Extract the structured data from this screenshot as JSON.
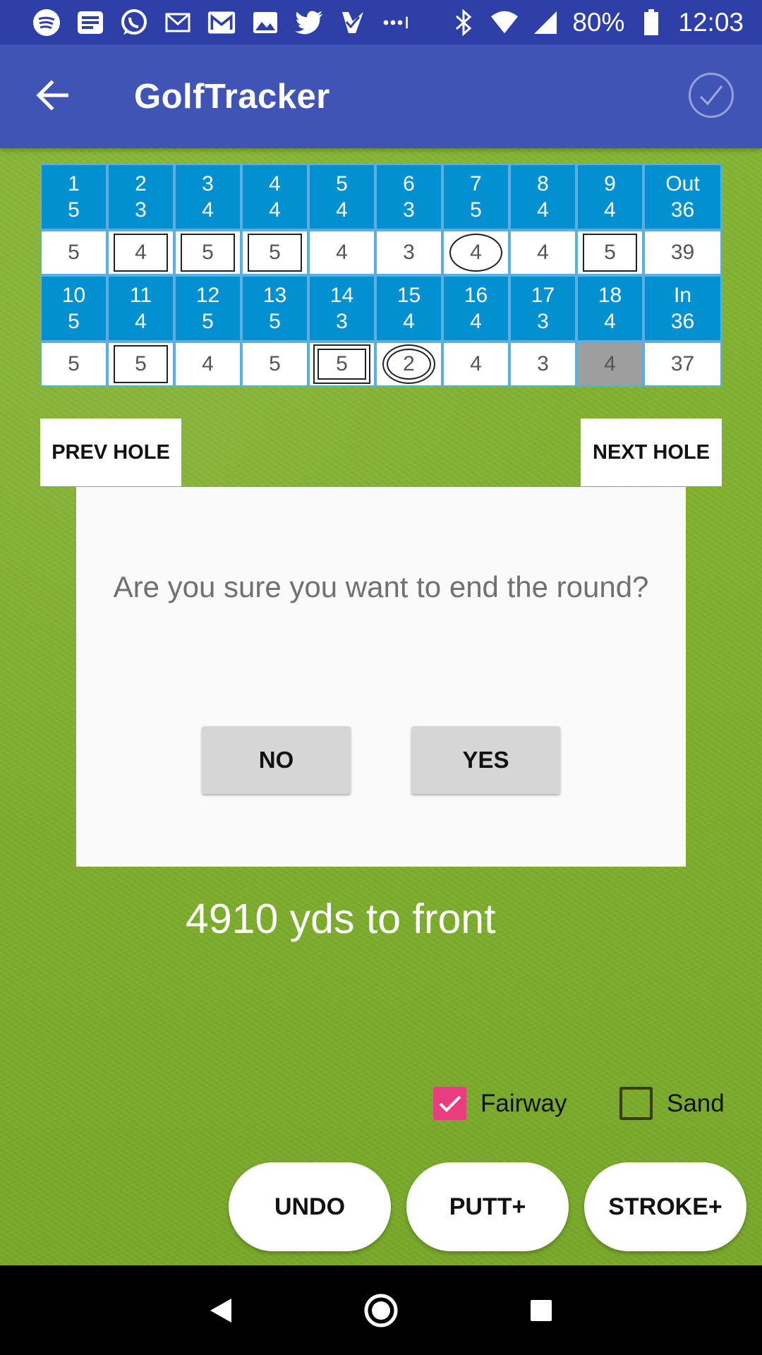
{
  "status_bar": {
    "battery": "80%",
    "time": "12:03",
    "left_icons": [
      "spotify-icon",
      "news-icon",
      "whatsapp-icon",
      "mail-icon",
      "gmail-icon",
      "photos-icon",
      "twitter-icon",
      "check-app-icon",
      "more-dots-icon"
    ],
    "right_icons": [
      "bluetooth-icon",
      "wifi-icon",
      "signal-icon",
      "battery-icon"
    ]
  },
  "app_bar": {
    "title": "GolfTracker"
  },
  "scorecard": {
    "front": {
      "holes": [
        {
          "hole": "1",
          "par": "5",
          "score": "5",
          "mark": "none"
        },
        {
          "hole": "2",
          "par": "3",
          "score": "4",
          "mark": "box"
        },
        {
          "hole": "3",
          "par": "4",
          "score": "5",
          "mark": "box"
        },
        {
          "hole": "4",
          "par": "4",
          "score": "5",
          "mark": "box"
        },
        {
          "hole": "5",
          "par": "4",
          "score": "4",
          "mark": "none"
        },
        {
          "hole": "6",
          "par": "3",
          "score": "3",
          "mark": "none"
        },
        {
          "hole": "7",
          "par": "5",
          "score": "4",
          "mark": "circle"
        },
        {
          "hole": "8",
          "par": "4",
          "score": "4",
          "mark": "none"
        },
        {
          "hole": "9",
          "par": "4",
          "score": "5",
          "mark": "box"
        }
      ],
      "total_label": "Out",
      "total_par": "36",
      "total_score": "39"
    },
    "back": {
      "holes": [
        {
          "hole": "10",
          "par": "5",
          "score": "5",
          "mark": "none"
        },
        {
          "hole": "11",
          "par": "4",
          "score": "5",
          "mark": "box"
        },
        {
          "hole": "12",
          "par": "5",
          "score": "4",
          "mark": "none"
        },
        {
          "hole": "13",
          "par": "5",
          "score": "5",
          "mark": "none"
        },
        {
          "hole": "14",
          "par": "3",
          "score": "5",
          "mark": "double-box"
        },
        {
          "hole": "15",
          "par": "4",
          "score": "2",
          "mark": "double-circle"
        },
        {
          "hole": "16",
          "par": "4",
          "score": "4",
          "mark": "none"
        },
        {
          "hole": "17",
          "par": "3",
          "score": "3",
          "mark": "none"
        },
        {
          "hole": "18",
          "par": "4",
          "score": "4",
          "mark": "current"
        }
      ],
      "total_label": "In",
      "total_par": "36",
      "total_score": "37"
    }
  },
  "nav": {
    "prev": "PREV HOLE",
    "next": "NEXT HOLE"
  },
  "distance": "4910 yds to front",
  "dialog": {
    "message": "Are you sure you want to end the round?",
    "no": "NO",
    "yes": "YES"
  },
  "checkboxes": {
    "fairway": {
      "label": "Fairway",
      "checked": true
    },
    "sand": {
      "label": "Sand",
      "checked": false
    }
  },
  "actions": {
    "undo": "UNDO",
    "putt": "PUTT+",
    "stroke": "STROKE+"
  },
  "colors": {
    "status_bar": "#2e3fa8",
    "app_bar": "#4054b6",
    "hole_cell": "#0290d0",
    "checkbox_accent": "#ea3d7e"
  }
}
